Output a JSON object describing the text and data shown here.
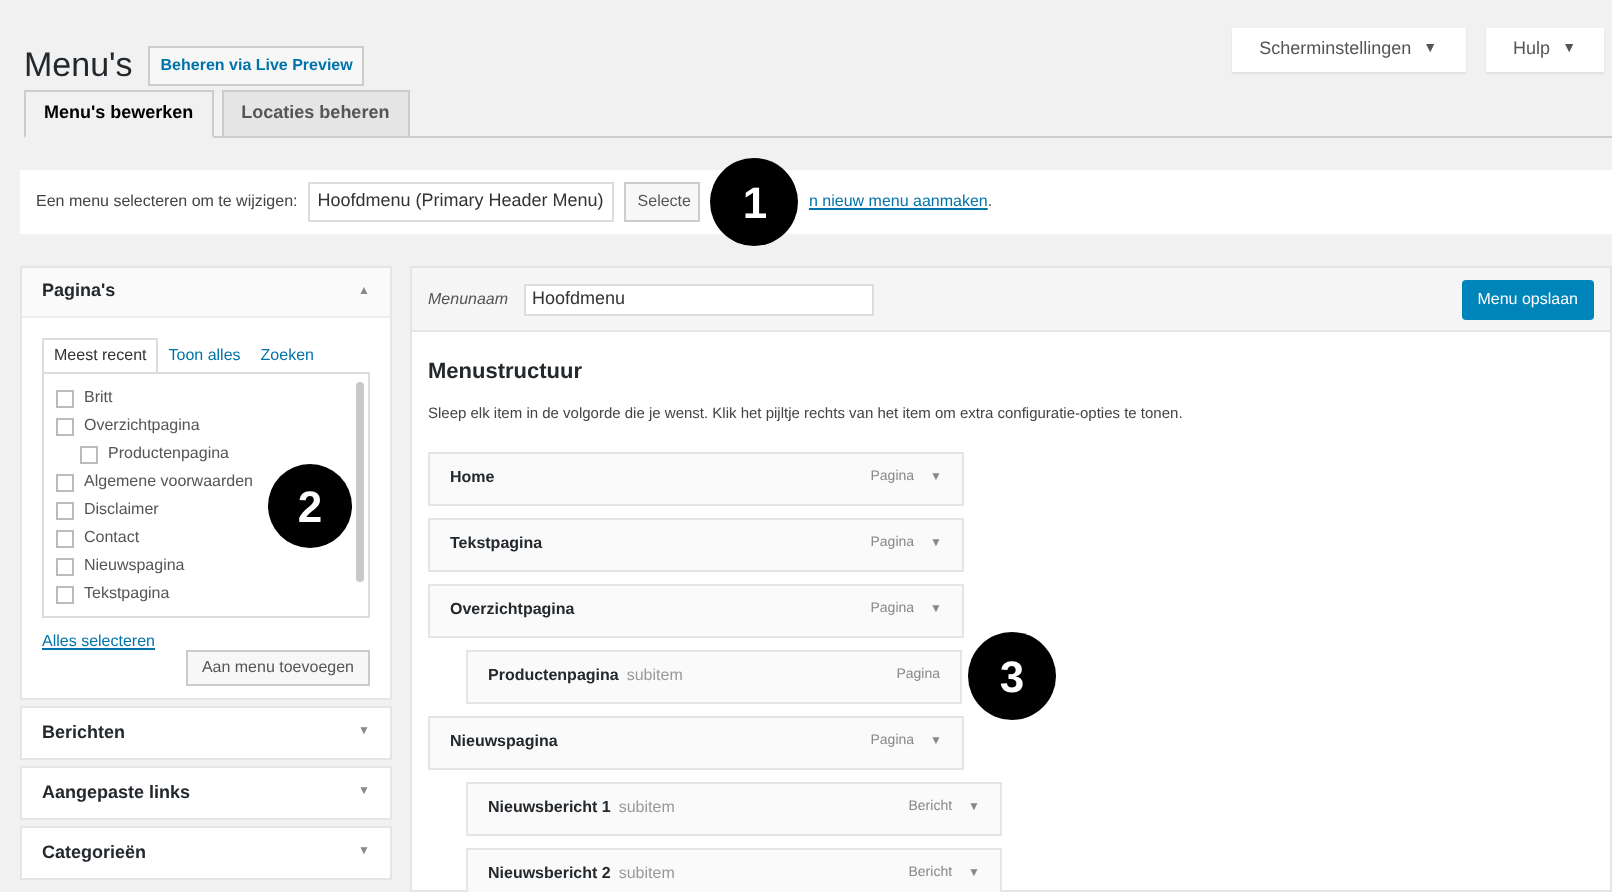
{
  "top_buttons": [
    {
      "label": "Scherminstellingen",
      "caret": "▼"
    },
    {
      "label": "Hulp",
      "caret": "▼"
    }
  ],
  "title": "Menu's",
  "title_action": "Beheren via Live Preview",
  "tabs": [
    {
      "label": "Menu's bewerken",
      "selected": true
    },
    {
      "label": "Locaties beheren",
      "selected": false
    }
  ],
  "select_bar": {
    "label": "Een menu selecteren om te wijzigen:",
    "dropdown": "Hoofdmenu (Primary Header Menu)",
    "button": "Selecte",
    "link": "n nieuw menu aanmaken",
    "after": "."
  },
  "sidebar": {
    "panels": [
      {
        "title": "Pagina's",
        "expanded": true,
        "arrow": "▲",
        "tabs": [
          {
            "label": "Meest recent",
            "selected": true
          },
          {
            "label": "Toon alles",
            "selected": false
          },
          {
            "label": "Zoeken",
            "selected": false
          }
        ],
        "items": [
          {
            "label": "Britt",
            "checked": false
          },
          {
            "label": "Overzichtpagina",
            "checked": false,
            "children": [
              {
                "label": "Productenpagina",
                "checked": false
              }
            ]
          },
          {
            "label": "Algemene voorwaarden",
            "checked": false
          },
          {
            "label": "Disclaimer",
            "checked": false
          },
          {
            "label": "Contact",
            "checked": false
          },
          {
            "label": "Nieuwspagina",
            "checked": false
          },
          {
            "label": "Tekstpagina",
            "checked": false
          }
        ],
        "select_all": "Alles selecteren",
        "add_button": "Aan menu toevoegen"
      },
      {
        "title": "Berichten",
        "expanded": false,
        "arrow": "▼"
      },
      {
        "title": "Aangepaste links",
        "expanded": false,
        "arrow": "▼"
      },
      {
        "title": "Categorieën",
        "expanded": false,
        "arrow": "▼"
      }
    ]
  },
  "menu": {
    "name_label": "Menunaam",
    "name_value": "Hoofdmenu",
    "save_button": "Menu opslaan",
    "heading": "Menustructuur",
    "description": "Sleep elk item in de volgorde die je wenst. Klik het pijltje rechts van het item om extra configuratie-opties te tonen.",
    "items": [
      {
        "title": "Home",
        "type": "Pagina",
        "toggle": "▼"
      },
      {
        "title": "Tekstpagina",
        "type": "Pagina",
        "toggle": "▼"
      },
      {
        "title": "Overzichtpagina",
        "type": "Pagina",
        "toggle": "▼",
        "children": [
          {
            "title": "Productenpagina",
            "sub": "subitem",
            "type": "Pagina"
          }
        ]
      },
      {
        "title": "Nieuwspagina",
        "type": "Pagina",
        "toggle": "▼",
        "children": [
          {
            "title": "Nieuwsbericht 1",
            "sub": "subitem",
            "type": "Bericht",
            "toggle": "▼"
          },
          {
            "title": "Nieuwsbericht 2",
            "sub": "subitem",
            "type": "Bericht",
            "toggle": "▼"
          }
        ]
      }
    ]
  },
  "callouts": [
    "1",
    "2",
    "3"
  ]
}
